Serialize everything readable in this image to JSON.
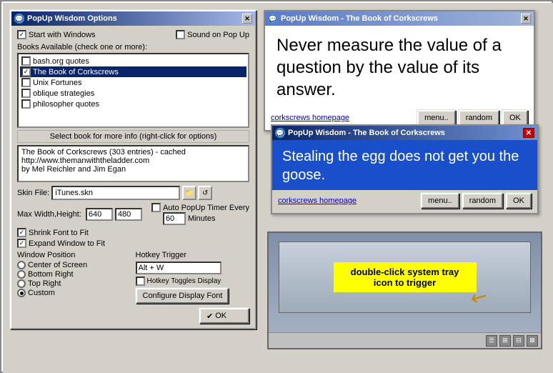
{
  "options_panel": {
    "title": "PopUp Wisdom Options",
    "start_with_windows": "Start with Windows",
    "sound_on_popup": "Sound on Pop Up",
    "books_label": "Books Available (check one or more):",
    "books": [
      {
        "name": "bash.org quotes",
        "checked": false,
        "selected": false
      },
      {
        "name": "The Book of Corkscrews",
        "checked": true,
        "selected": true
      },
      {
        "name": "Unix Fortunes",
        "checked": false,
        "selected": false
      },
      {
        "name": "oblique strategies",
        "checked": false,
        "selected": false
      },
      {
        "name": "philosopher quotes",
        "checked": false,
        "selected": false
      }
    ],
    "select_hint": "Select book for more info (right-click for options)",
    "info_text": "The Book of Corkscrews (303 entries) - cached\nhttp://www.themanwiththeladder.com\nby Mel Reichler and Jim Egan",
    "skin_label": "Skin File:",
    "skin_value": "iTunes.skn",
    "max_label": "Max Width,Height:",
    "max_width": "640",
    "max_height": "480",
    "auto_popup_label": "Auto PopUp Timer Every",
    "auto_popup_minutes": "60",
    "minutes_label": "Minutes",
    "shrink_font": "Shrink Font to Fit",
    "expand_window": "Expand Window to Fit",
    "window_position_label": "Window Position",
    "positions": [
      {
        "label": "Center of Screen",
        "selected": false
      },
      {
        "label": "Bottom Right",
        "selected": false
      },
      {
        "label": "Top Right",
        "selected": false
      },
      {
        "label": "Custom",
        "selected": true
      }
    ],
    "hotkey_label": "Hotkey Trigger",
    "hotkey_value": "Alt + W",
    "hotkey_toggles": "Hotkey Toggles Display",
    "configure_font_btn": "Configure Display Font",
    "ok_btn": "OK"
  },
  "popup_white": {
    "title": "PopUp Wisdom - The Book of Corkscrews",
    "quote": "Never measure the value of a question by the value of its answer.",
    "link": "corkscrews homepage",
    "menu_btn": "menu..",
    "random_btn": "random",
    "ok_btn": "OK"
  },
  "popup_blue": {
    "title": "PopUp Wisdom - The Book of Corkscrews",
    "quote": "Stealing the egg does not get you the goose.",
    "link": "corkscrews homepage",
    "menu_btn": "menu..",
    "random_btn": "random",
    "ok_btn": "OK"
  },
  "tutorial": {
    "label": "double-click system tray\nicon to trigger",
    "tray_icons": [
      "☰",
      "⊞",
      "⊟",
      "⊠"
    ]
  }
}
